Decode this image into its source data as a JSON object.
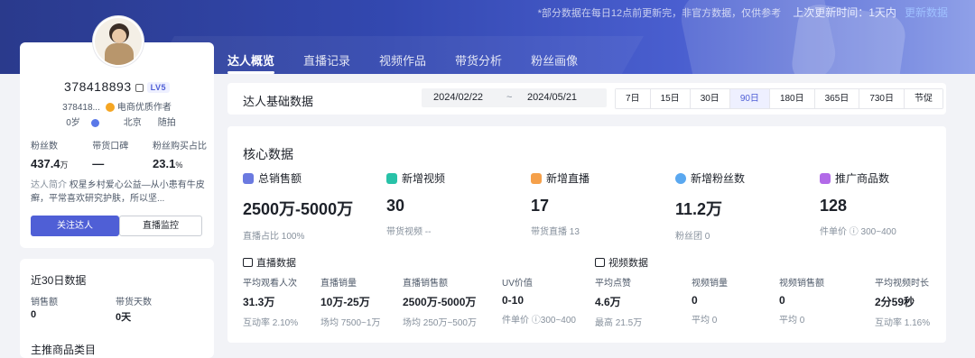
{
  "header": {
    "note": "*部分数据在每日12点前更新完，非官方数据，仅供参考",
    "update_label": "上次更新时间：1天内",
    "update_link": "更新数据"
  },
  "tabs": [
    "达人概览",
    "直播记录",
    "视频作品",
    "带货分析",
    "粉丝画像"
  ],
  "profile": {
    "name": "378418893",
    "level": "LV5",
    "sub_id": "378418...",
    "author_tag": "电商优质作者",
    "age": "0岁",
    "region": "北京",
    "tag": "随拍",
    "stats": [
      {
        "label": "粉丝数",
        "value": "437.4",
        "unit": "万"
      },
      {
        "label": "带货口碑",
        "value": "—",
        "unit": ""
      },
      {
        "label": "粉丝购买占比",
        "value": "23.1",
        "unit": "%"
      }
    ],
    "intro_label": "达人简介",
    "intro_text": "权星乡村爱心公益—从小患有牛皮癣，平常喜欢研究护肤，所以坚...",
    "follow_button": "关注达人",
    "monitor_button": "直播监控"
  },
  "recent30": {
    "title": "近30日数据",
    "labels": [
      "销售额",
      "带货天数"
    ],
    "values": [
      "0",
      "0天"
    ],
    "next_title": "主推商品类目"
  },
  "base": {
    "title": "达人基础数据",
    "date_start": "2024/02/22",
    "date_sep": "~",
    "date_end": "2024/05/21",
    "periods": [
      "7日",
      "15日",
      "30日",
      "90日",
      "180日",
      "365日",
      "730日",
      "节促"
    ],
    "selected_period": "90日"
  },
  "core": {
    "title": "核心数据",
    "metrics": [
      {
        "label": "总销售额",
        "value": "2500万-5000万",
        "sub": "直播占比 100%",
        "color": "#6b7ae0"
      },
      {
        "label": "新增视频",
        "value": "30",
        "sub": "带货视频 --",
        "color": "#28c2a8"
      },
      {
        "label": "新增直播",
        "value": "17",
        "sub": "带货直播 13",
        "color": "#f5a04a"
      },
      {
        "label": "新增粉丝数",
        "value": "11.2万",
        "sub": "粉丝团 0",
        "color": "#5aa8f0"
      },
      {
        "label": "推广商品数",
        "value": "128",
        "sub": "件单价 ⓘ 300~400",
        "color": "#b26ae8"
      }
    ],
    "live_title": "直播数据",
    "video_title": "视频数据",
    "live": [
      {
        "label": "平均观看人次",
        "value": "31.3万",
        "sub": "互动率 2.10%"
      },
      {
        "label": "直播销量",
        "value": "10万-25万",
        "sub": "场均 7500~1万"
      },
      {
        "label": "直播销售额",
        "value": "2500万-5000万",
        "sub": "场均 250万~500万"
      },
      {
        "label": "UV价值",
        "value": "0-10",
        "sub": "件单价 ⓘ300~400"
      }
    ],
    "video": [
      {
        "label": "平均点赞",
        "value": "4.6万",
        "sub": "最高 21.5万"
      },
      {
        "label": "视频销量",
        "value": "0",
        "sub": "平均 0"
      },
      {
        "label": "视频销售额",
        "value": "0",
        "sub": "平均 0"
      },
      {
        "label": "平均视频时长",
        "value": "2分59秒",
        "sub": "互动率 1.16%"
      }
    ]
  }
}
